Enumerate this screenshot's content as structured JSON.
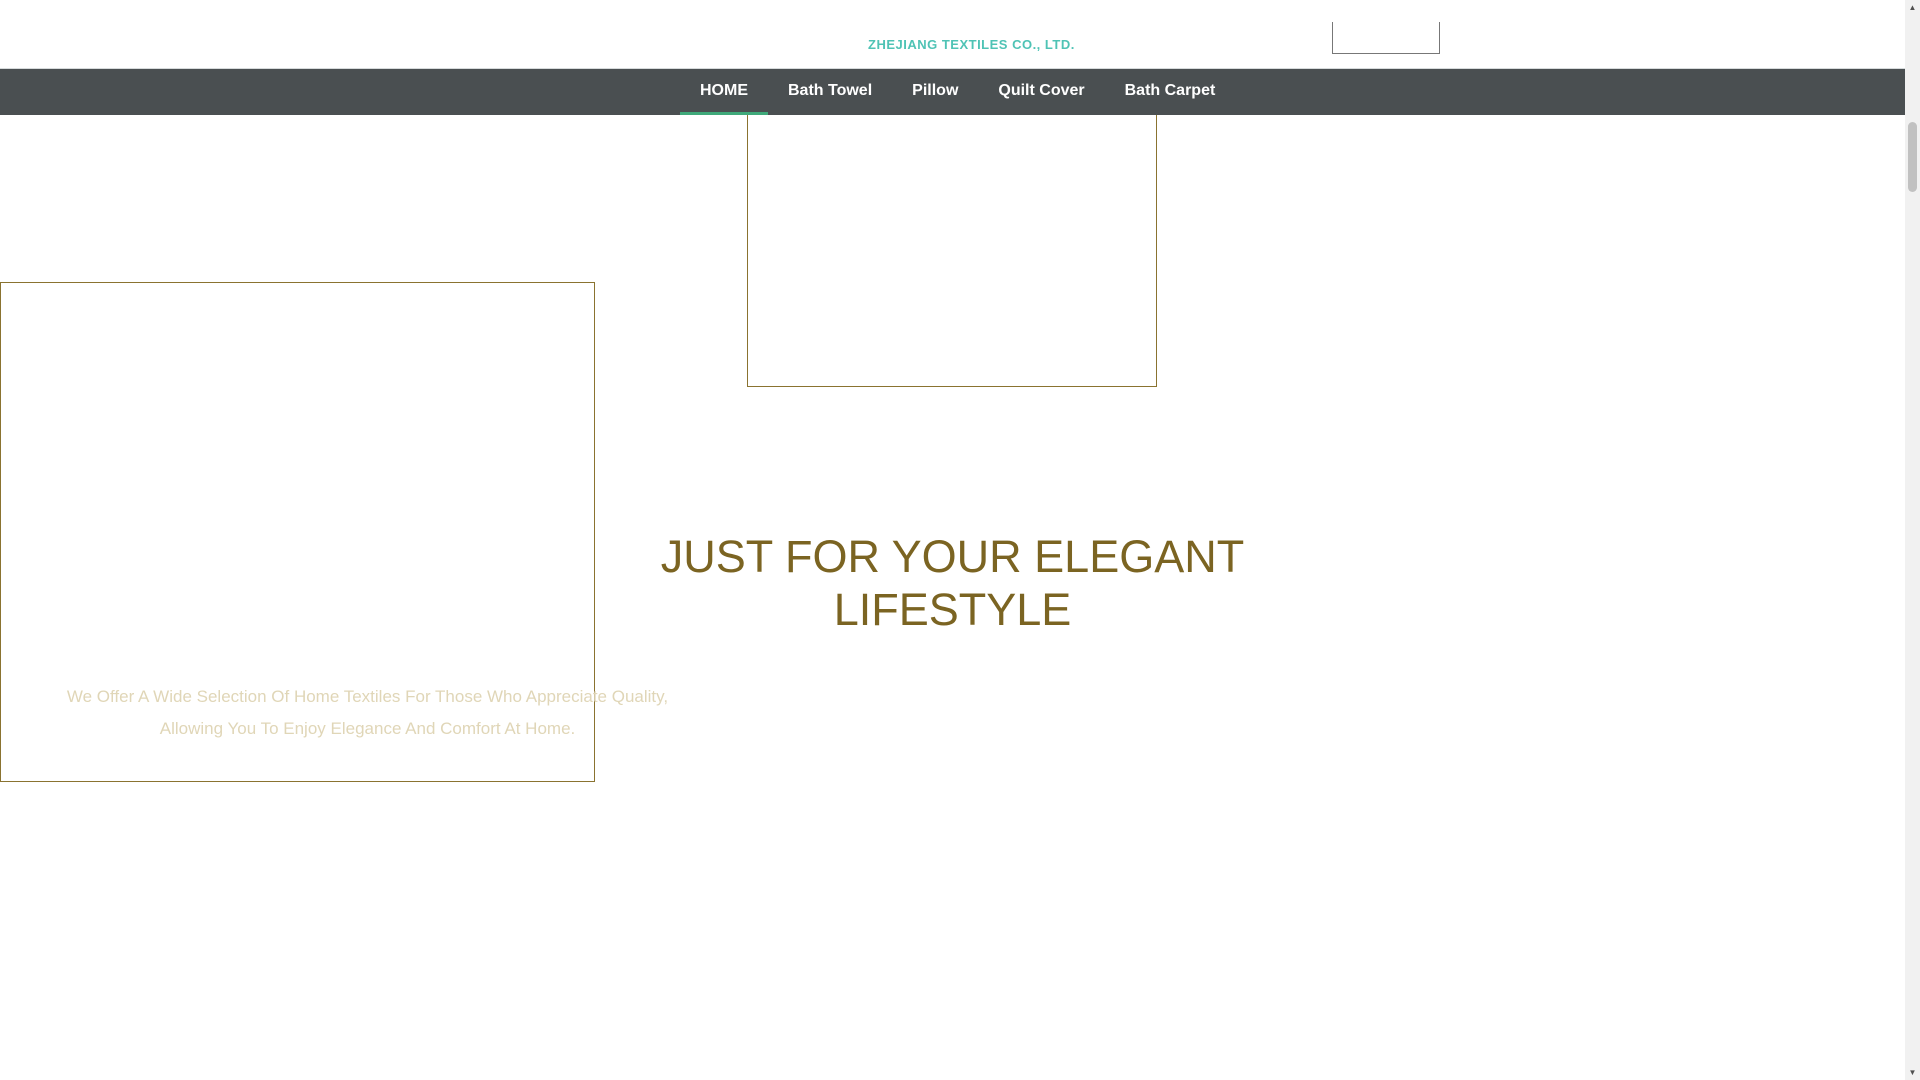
{
  "header": {
    "logo_text": "ZHEJIANG TEXTILES CO., LTD."
  },
  "nav": {
    "items": [
      {
        "label": "HOME",
        "active": true
      },
      {
        "label": "Bath Towel"
      },
      {
        "label": "Pillow"
      },
      {
        "label": "Quilt Cover"
      },
      {
        "label": "Bath Carpet"
      }
    ]
  },
  "hero": {
    "title_line1": "JUST FOR YOUR ELEGANT",
    "title_line2": "LIFESTYLE",
    "tagline_line1": "We Offer A Wide Selection Of Home Textiles For Those Who Appreciate Quality,",
    "tagline_line2": "Allowing You To Enjoy Elegance And Comfort At Home."
  },
  "scrollbar": {
    "up_icon": "triangle-up-icon",
    "down_icon": "triangle-down-icon"
  },
  "colors": {
    "nav_bg": "#4a4f51",
    "nav_active_underline": "#3fa97a",
    "gold": "#7b6422",
    "frame": "#8a7330",
    "logo": "#4fc3b5"
  }
}
